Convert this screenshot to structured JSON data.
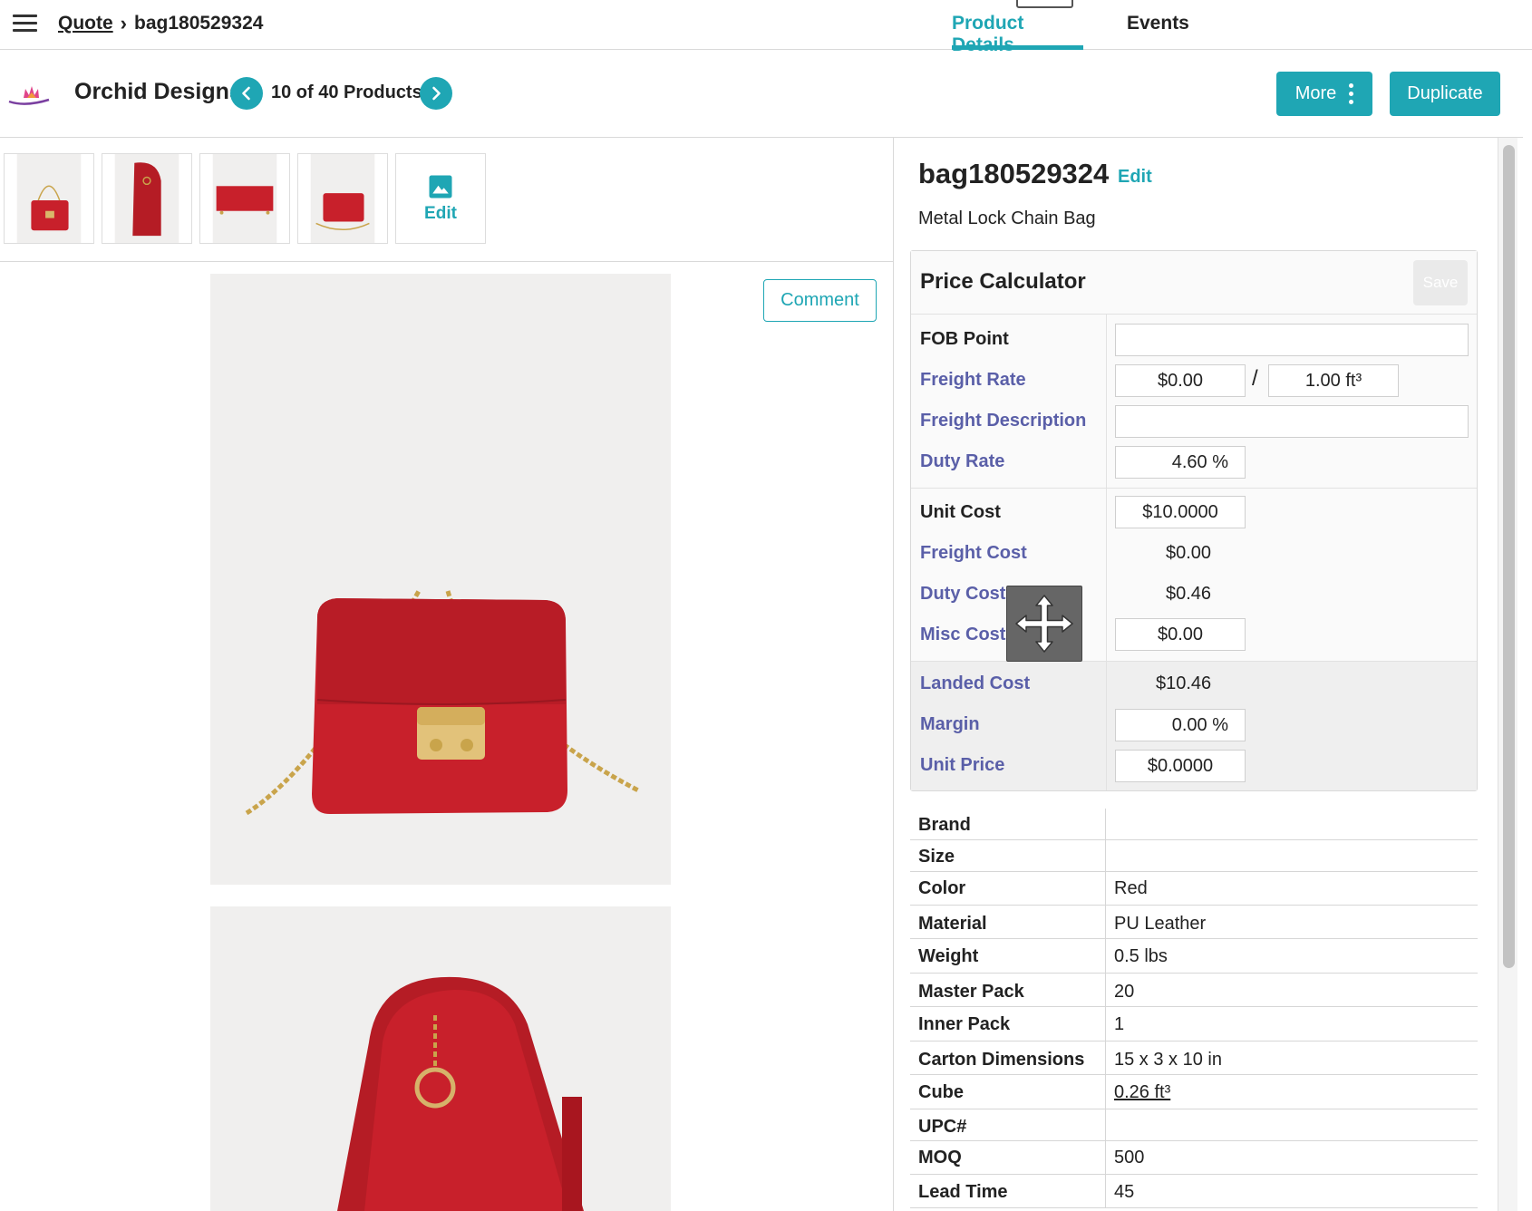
{
  "header": {
    "breadcrumb_root": "Quote",
    "breadcrumb_current": "bag180529324",
    "tabs": [
      {
        "label": "Product Details",
        "active": true
      },
      {
        "label": "Events",
        "active": false
      }
    ]
  },
  "subheader": {
    "vendor": "Orchid Designs",
    "counter": "10 of 40 Products",
    "more_label": "More",
    "duplicate_label": "Duplicate"
  },
  "gallery": {
    "edit_label": "Edit",
    "comment_label": "Comment"
  },
  "product": {
    "sku": "bag180529324",
    "edit_label": "Edit",
    "description": "Metal Lock Chain Bag"
  },
  "calculator": {
    "title": "Price Calculator",
    "save_label": "Save",
    "fob_point_label": "FOB Point",
    "fob_point_value": "",
    "freight_rate_label": "Freight Rate",
    "freight_rate_value": "$0.00",
    "freight_rate_separator": "/",
    "freight_rate_unit": "1.00 ft³",
    "freight_description_label": "Freight Description",
    "freight_description_value": "",
    "duty_rate_label": "Duty Rate",
    "duty_rate_value": "4.60 %",
    "unit_cost_label": "Unit Cost",
    "unit_cost_value": "$10.0000",
    "freight_cost_label": "Freight Cost",
    "freight_cost_value": "$0.00",
    "duty_cost_label": "Duty Cost",
    "duty_cost_value": "$0.46",
    "misc_cost_label": "Misc Cost",
    "misc_cost_value": "$0.00",
    "landed_cost_label": "Landed Cost",
    "landed_cost_value": "$10.46",
    "margin_label": "Margin",
    "margin_value": "0.00 %",
    "unit_price_label": "Unit Price",
    "unit_price_value": "$0.0000"
  },
  "attributes": [
    {
      "label": "Brand",
      "value": ""
    },
    {
      "label": "Size",
      "value": ""
    },
    {
      "label": "Color",
      "value": "Red"
    },
    {
      "label": "Material",
      "value": "PU Leather"
    },
    {
      "label": "Weight",
      "value": "0.5 lbs"
    },
    {
      "label": "Master Pack",
      "value": "20"
    },
    {
      "label": "Inner Pack",
      "value": "1"
    },
    {
      "label": "Carton Dimensions",
      "value": "15 x 3 x 10 in"
    },
    {
      "label": "Cube",
      "value": "0.26 ft³"
    },
    {
      "label": "UPC#",
      "value": ""
    },
    {
      "label": "MOQ",
      "value": "500"
    },
    {
      "label": "Lead Time",
      "value": "45"
    }
  ],
  "colors": {
    "accent": "#1fa6b4",
    "label_blue": "#5a5fa8",
    "bag_red": "#c8202b"
  },
  "icons": {
    "menu": "hamburger-menu-icon",
    "prev": "chevron-left-icon",
    "next": "chevron-right-icon",
    "more": "vertical-dots-icon",
    "image": "image-icon",
    "move": "move-arrows-icon"
  }
}
